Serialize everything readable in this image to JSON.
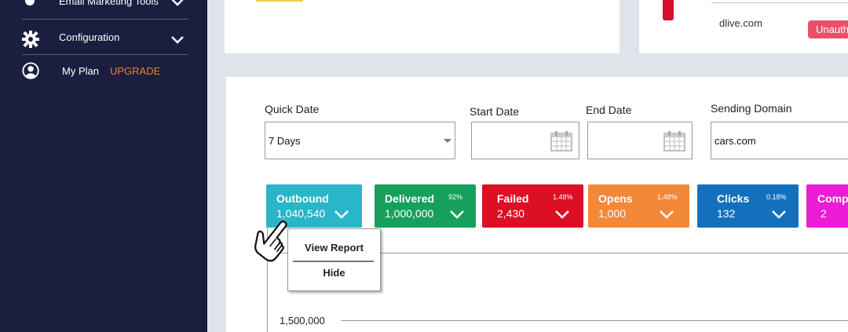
{
  "sidebar": {
    "items": [
      {
        "label": "Email Marketing Tools",
        "icon": "circle-icon"
      },
      {
        "label": "Configuration",
        "icon": "gear-icon"
      },
      {
        "label": "My Plan",
        "icon": "user-icon",
        "badge": "UPGRADE"
      }
    ]
  },
  "top_right": {
    "domain": "dlive.com",
    "status": "Unauth"
  },
  "filters": {
    "quick_date": {
      "label": "Quick Date",
      "value": "7 Days"
    },
    "start_date": {
      "label": "Start Date",
      "value": ""
    },
    "end_date": {
      "label": "End Date",
      "value": ""
    },
    "sending_domain": {
      "label": "Sending Domain",
      "value": "cars.com"
    }
  },
  "stats": [
    {
      "name": "Outbound",
      "value": "1,040,540",
      "pct": "",
      "color": "#29b6c8"
    },
    {
      "name": "Delivered",
      "value": "1,000,000",
      "pct": "92%",
      "color": "#16a05c"
    },
    {
      "name": "Failed",
      "value": "2,430",
      "pct": "1.48%",
      "color": "#dc0f25"
    },
    {
      "name": "Opens",
      "value": "1,000",
      "pct": "1.48%",
      "color": "#f38839"
    },
    {
      "name": "Clicks",
      "value": "132",
      "pct": "0.18%",
      "color": "#1470bd"
    },
    {
      "name": "Comp",
      "value": "2",
      "pct": "",
      "color": "#ec1bd5"
    }
  ],
  "popup": {
    "view_report": "View Report",
    "hide": "Hide"
  },
  "chart": {
    "ytick": "1,500,000"
  }
}
